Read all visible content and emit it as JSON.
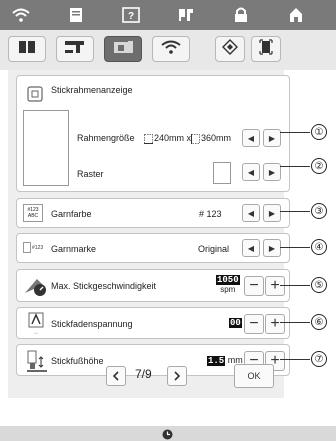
{
  "top_icons": [
    "wifi-icon",
    "page-icon",
    "help-icon",
    "embroidery-icon",
    "lock-icon",
    "home-icon"
  ],
  "tabs": [
    "book-icon",
    "sewing-machine-icon",
    "embroidery-machine-icon",
    "wifi-icon"
  ],
  "frame_display": {
    "title": "Stickrahmenanzeige",
    "frame_size_label": "Rahmengröße",
    "frame_size_value_w": "240mm x",
    "frame_size_value_h": "360mm",
    "grid_label": "Raster"
  },
  "thread_color": {
    "label": "Garnfarbe",
    "value": "# 123",
    "icon_text_top": "#123",
    "icon_text_bottom": "ABC"
  },
  "thread_brand": {
    "label": "Garnmarke",
    "value": "Original",
    "icon_text": "#123"
  },
  "max_speed": {
    "label": "Max. Stickgeschwindigkeit",
    "value": "1050",
    "unit": "spm"
  },
  "tension": {
    "label": "Stickfadenspannung",
    "value": "00"
  },
  "foot_height": {
    "label": "Stickfußhöhe",
    "value": "1.5",
    "unit": "mm"
  },
  "pager": {
    "page": "7/9"
  },
  "ok_label": "OK",
  "callouts": [
    "①",
    "②",
    "③",
    "④",
    "⑤",
    "⑥",
    "⑦"
  ]
}
